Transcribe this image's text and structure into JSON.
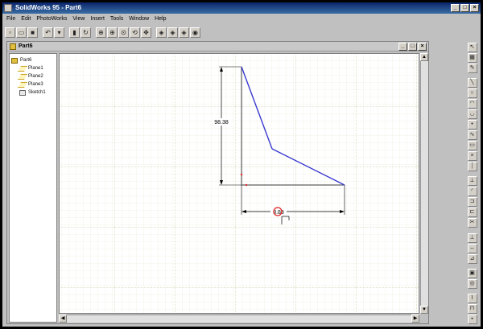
{
  "app": {
    "title": "SolidWorks 95 - Part6"
  },
  "window_controls": [
    "_",
    "□",
    "×"
  ],
  "menu": [
    "File",
    "Edit",
    "PhotoWorks",
    "View",
    "Insert",
    "Tools",
    "Window",
    "Help"
  ],
  "toolbar": {
    "items": [
      {
        "name": "new-icon",
        "glyph": "▫"
      },
      {
        "name": "open-icon",
        "glyph": "▭"
      },
      {
        "name": "save-icon",
        "glyph": "■"
      },
      {
        "name": "undo-icon",
        "glyph": "↶",
        "sep": true
      },
      {
        "name": "undo-dropdown-icon",
        "glyph": "▾"
      },
      {
        "name": "rebuild-icon",
        "glyph": "▮",
        "sep": true
      },
      {
        "name": "rotate-part-icon",
        "glyph": "↻"
      },
      {
        "name": "zoom-fit-icon",
        "glyph": "⊕",
        "sep": true
      },
      {
        "name": "zoom-in-icon",
        "glyph": "⊕"
      },
      {
        "name": "zoom-area-icon",
        "glyph": "⊙"
      },
      {
        "name": "rotate-view-icon",
        "glyph": "⟲"
      },
      {
        "name": "pan-icon",
        "glyph": "✥"
      },
      {
        "name": "wireframe-icon",
        "glyph": "◈",
        "sep": true
      },
      {
        "name": "hidden-lines-icon",
        "glyph": "◈"
      },
      {
        "name": "hidden-removed-icon",
        "glyph": "◈"
      },
      {
        "name": "shaded-icon",
        "glyph": "◉"
      }
    ]
  },
  "colors": {
    "profile": "#3a3ad0",
    "dimension": "#000000",
    "grid": "#c8c8a0",
    "highlight": "#e02020"
  },
  "document": {
    "title": "Part6",
    "tree": [
      {
        "label": "Part6",
        "icon": "part-icon",
        "level": 0
      },
      {
        "label": "Plane1",
        "icon": "plane-icon",
        "level": 1
      },
      {
        "label": "Plane2",
        "icon": "plane-icon",
        "level": 1
      },
      {
        "label": "Plane3",
        "icon": "plane-icon",
        "level": 1
      },
      {
        "label": "Sketch1",
        "icon": "sketch-icon",
        "level": 1
      }
    ],
    "dimensions": {
      "vertical": "98.38",
      "horizontal": "8.88"
    }
  },
  "right_toolbar": [
    "select-icon",
    "grid-icon",
    "sketch-icon",
    "gap",
    "line-icon",
    "circle-icon",
    "arc-icon",
    "tangent-arc-icon",
    "point-icon",
    "spline-icon",
    "rectangle-icon",
    "point-icon-2",
    "centerline-icon",
    "gap",
    "mirror-icon",
    "fillet-icon",
    "offset-icon",
    "convert-icon",
    "trim-icon",
    "gap",
    "relations-icon",
    "dimension-icon",
    "constraint-icon",
    "gap",
    "extrude-icon",
    "revolve-icon",
    "gap",
    "sweep-icon",
    "loft-icon",
    "cut-icon"
  ]
}
